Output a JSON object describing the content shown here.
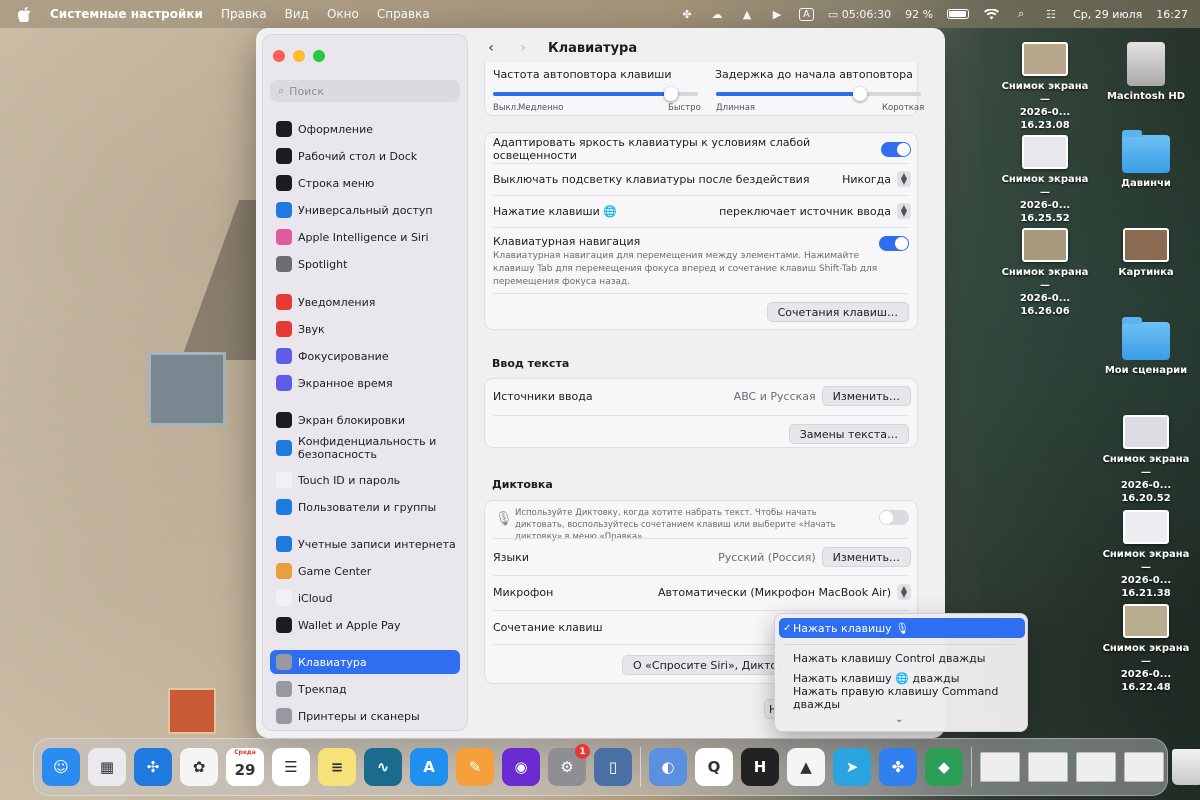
{
  "menubar": {
    "app_name": "Системные настройки",
    "menus": [
      "Правка",
      "Вид",
      "Окно",
      "Справка"
    ],
    "timer": "05:06:30",
    "input_lang": "A",
    "battery": "92 %",
    "date": "Ср, 29 июля",
    "time": "16:27"
  },
  "sidebar": {
    "search_placeholder": "Поиск",
    "items": [
      {
        "label": "Оформление",
        "color": "#1d1d1f",
        "icon": "appearance-icon"
      },
      {
        "label": "Рабочий стол и Dock",
        "color": "#1d1d1f",
        "icon": "desktop-dock-icon"
      },
      {
        "label": "Строка меню",
        "color": "#1d1d1f",
        "icon": "menubar-icon"
      },
      {
        "label": "Универсальный доступ",
        "color": "#1f7ae0",
        "icon": "accessibility-icon"
      },
      {
        "label": "Apple Intelligence и Siri",
        "color": "#e05a9c",
        "icon": "siri-icon"
      },
      {
        "label": "Spotlight",
        "color": "#6d6b72",
        "icon": "spotlight-icon"
      },
      {
        "label": "Уведомления",
        "color": "#e53935",
        "icon": "notifications-icon"
      },
      {
        "label": "Звук",
        "color": "#e53935",
        "icon": "sound-icon"
      },
      {
        "label": "Фокусирование",
        "color": "#5e5ce6",
        "icon": "focus-icon"
      },
      {
        "label": "Экранное время",
        "color": "#5e5ce6",
        "icon": "screen-time-icon"
      },
      {
        "label": "Экран блокировки",
        "color": "#1d1d1f",
        "icon": "lock-screen-icon"
      },
      {
        "label": "Конфиденциальность и безопасность",
        "color": "#1f7ae0",
        "icon": "privacy-icon"
      },
      {
        "label": "Touch ID и пароль",
        "color": "#f2f0f4",
        "icon": "touch-id-icon"
      },
      {
        "label": "Пользователи и группы",
        "color": "#1f7ae0",
        "icon": "users-icon"
      },
      {
        "label": "Учетные записи интернета",
        "color": "#1f7ae0",
        "icon": "internet-accounts-icon"
      },
      {
        "label": "Game Center",
        "color": "#e8a03c",
        "icon": "game-center-icon"
      },
      {
        "label": "iCloud",
        "color": "#f2f0f4",
        "icon": "icloud-icon"
      },
      {
        "label": "Wallet и Apple Pay",
        "color": "#1d1d1f",
        "icon": "wallet-icon"
      },
      {
        "label": "Клавиатура",
        "color": "#9a98a0",
        "icon": "keyboard-icon"
      },
      {
        "label": "Трекпад",
        "color": "#9a98a0",
        "icon": "trackpad-icon"
      },
      {
        "label": "Принтеры и сканеры",
        "color": "#9a98a0",
        "icon": "printer-icon"
      }
    ],
    "selected": "Клавиатура"
  },
  "main": {
    "title": "Клавиатура",
    "repeat": {
      "rate_label": "Частота автоповтора клавиши",
      "rate_min": "Выкл.",
      "rate_slow": "Медленно",
      "rate_fast": "Быстро",
      "rate_level": 0.87,
      "delay_label": "Задержка до начала автоповтора",
      "delay_long": "Длинная",
      "delay_short": "Короткая",
      "delay_level": 0.7
    },
    "brightness_label": "Адаптировать яркость клавиатуры к условиям слабой освещенности",
    "brightness_on": true,
    "backlight_label": "Выключать подсветку клавиатуры после бездействия",
    "backlight_value": "Никогда",
    "key_press_label": "Нажатие клавиши",
    "key_press_value": "переключает источник ввода",
    "nav_label": "Клавиатурная навигация",
    "nav_desc": "Клавиатурная навигация для перемещения между элементами. Нажимайте клавишу Tab для перемещения фокуса вперед и сочетание клавиш Shift-Tab для перемещения фокуса назад.",
    "nav_on": true,
    "shortcuts_button": "Сочетания клавиш…",
    "text_input_title": "Ввод текста",
    "input_sources_label": "Источники ввода",
    "input_sources_value": "ABC и Русская",
    "change_button": "Изменить…",
    "replacements_button": "Замены текста…",
    "dictation_title": "Диктовка",
    "dictation_desc": "Используйте Диктовку, когда хотите набрать текст. Чтобы начать диктовать, воспользуйтесь сочетанием клавиш или выберите «Начать диктовку» в меню «Правка».",
    "dictation_on": false,
    "languages_label": "Языки",
    "languages_value": "Русский (Россия)",
    "languages_button": "Изменить…",
    "mic_label": "Микрофон",
    "mic_value": "Автоматически (Микрофон MacBook Air)",
    "shortcut_label": "Сочетание клавиш",
    "siri_button": "О «Спросите Siri», Диктовк",
    "bottom_partial": "Н"
  },
  "popup": {
    "options": [
      "Нажать клавишу",
      "Нажать клавишу Control дважды",
      "Нажать клавишу",
      "Нажать правую клавишу Command дважды"
    ],
    "option3_suffix": "дважды",
    "check": "✓",
    "selected_index": 0
  },
  "desktop": {
    "icons": [
      {
        "name": "Снимок экрана —\n2026-0... 16.23.08",
        "kind": "thumb"
      },
      {
        "name": "Macintosh HD",
        "kind": "hd"
      },
      {
        "name": "Снимок экрана —\n2026-0... 16.25.52",
        "kind": "thumb"
      },
      {
        "name": "Давинчи",
        "kind": "folder"
      },
      {
        "name": "Снимок экрана —\n2026-0... 16.26.06",
        "kind": "thumb"
      },
      {
        "name": "Картинка",
        "kind": "thumb"
      },
      {
        "name": "Мои сценарии",
        "kind": "folder"
      },
      {
        "name": "Снимок экрана —\n2026-0... 16.20.52",
        "kind": "thumb"
      },
      {
        "name": "Снимок экрана —\n2026-0... 16.21.38",
        "kind": "thumb"
      },
      {
        "name": "Снимок экрана —\n2026-0... 16.22.48",
        "kind": "thumb"
      }
    ]
  },
  "dock": {
    "apps": [
      {
        "name": "finder",
        "color": "#2a8cf0",
        "glyph": "☺"
      },
      {
        "name": "launchpad",
        "color": "#e9e9ee",
        "glyph": "▦"
      },
      {
        "name": "safari",
        "color": "#1f7ae0",
        "glyph": "✣"
      },
      {
        "name": "photos",
        "color": "#f5f5f5",
        "glyph": "✿"
      },
      {
        "name": "calendar",
        "color": "#ffffff",
        "glyph": "29"
      },
      {
        "name": "reminders",
        "color": "#ffffff",
        "glyph": "☰"
      },
      {
        "name": "notes",
        "color": "#f7e27a",
        "glyph": "≡"
      },
      {
        "name": "freeform",
        "color": "#1b6b8f",
        "glyph": "∿"
      },
      {
        "name": "app-store",
        "color": "#1f8ff0",
        "glyph": "A"
      },
      {
        "name": "pages",
        "color": "#f5a03a",
        "glyph": "✎"
      },
      {
        "name": "firefox",
        "color": "#6a2bd0",
        "glyph": "◉"
      },
      {
        "name": "system-settings",
        "color": "#8e8e93",
        "glyph": "⚙"
      },
      {
        "name": "iphone-mirroring",
        "color": "#4a6fa5",
        "glyph": "▯"
      },
      {
        "name": "finder-helper",
        "color": "#5b8fe0",
        "glyph": "◐"
      },
      {
        "name": "quicktime",
        "color": "#ffffff",
        "glyph": "Q"
      },
      {
        "name": "handbrake-app",
        "color": "#222222",
        "glyph": "H"
      },
      {
        "name": "vlc",
        "color": "#f5f5f5",
        "glyph": "▲"
      },
      {
        "name": "telegram",
        "color": "#2aa3e0",
        "glyph": "➤"
      },
      {
        "name": "perplexity-app",
        "color": "#2f80ed",
        "glyph": "✤"
      },
      {
        "name": "green-app",
        "color": "#2e9e56",
        "glyph": "◆"
      }
    ],
    "settings_badge": "1",
    "calendar_day_label": "Среда"
  },
  "colors": {
    "accent": "#2f6ef0"
  }
}
